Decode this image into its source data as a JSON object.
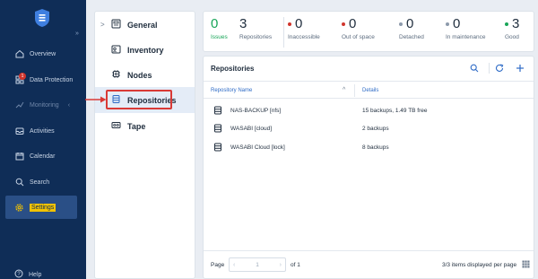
{
  "sidebar": {
    "collapse": "»",
    "alert_badge": "1",
    "items": [
      {
        "label": "Overview"
      },
      {
        "label": "Data Protection"
      },
      {
        "label": "Monitoring"
      },
      {
        "label": "Activities"
      },
      {
        "label": "Calendar"
      },
      {
        "label": "Search"
      },
      {
        "label": "Settings"
      }
    ],
    "help": "Help"
  },
  "settings_menu": {
    "items": [
      {
        "label": "General"
      },
      {
        "label": "Inventory"
      },
      {
        "label": "Nodes"
      },
      {
        "label": "Repositories"
      },
      {
        "label": "Tape"
      }
    ],
    "expand_glyph": ">"
  },
  "stats": [
    {
      "value": "0",
      "label": "Issues",
      "color": "#18a558"
    },
    {
      "value": "3",
      "label": "Repositories",
      "color": "#1f2d3d"
    },
    {
      "value": "0",
      "label": "Inaccessible",
      "color": "#d0342c"
    },
    {
      "value": "0",
      "label": "Out of space",
      "color": "#d0342c"
    },
    {
      "value": "0",
      "label": "Detached",
      "color": "#8c9aab"
    },
    {
      "value": "0",
      "label": "In maintenance",
      "color": "#8c9aab"
    },
    {
      "value": "3",
      "label": "Good",
      "color": "#18a558"
    }
  ],
  "repositories": {
    "title": "Repositories",
    "columns": {
      "name": "Repository Name",
      "details": "Details"
    },
    "rows": [
      {
        "name": "NAS-BACKUP [nfs]",
        "details": "15 backups, 1.49 TB free"
      },
      {
        "name": "WASABI [cloud]",
        "details": "2 backups"
      },
      {
        "name": "WASABI Cloud [lock]",
        "details": "8 backups"
      }
    ],
    "footer": {
      "page_label": "Page",
      "current_page": "1",
      "of_label": "of 1",
      "items_info": "3/3 items displayed per page"
    }
  },
  "colors": {
    "sidebar_bg": "#0f2d57",
    "accent": "#2e6bc6",
    "highlight": "#d93a36",
    "settings_highlight": "#f2c200"
  }
}
